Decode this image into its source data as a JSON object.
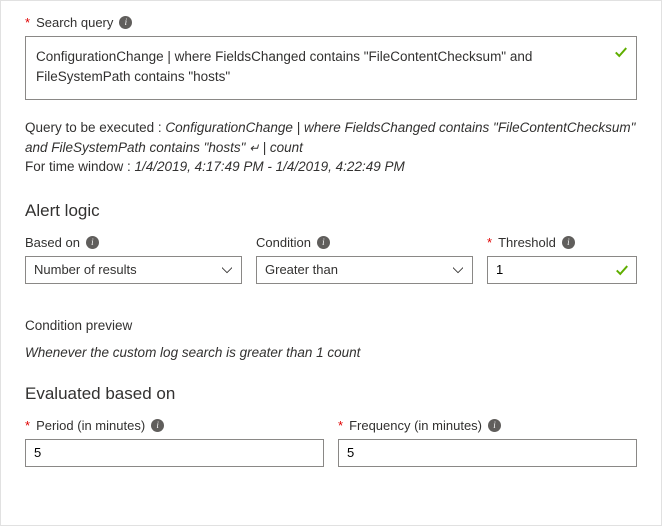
{
  "search_query": {
    "label": "Search query",
    "value": "ConfigurationChange | where FieldsChanged contains \"FileContentChecksum\" and FileSystemPath contains \"hosts\""
  },
  "query_meta": {
    "prefix": "Query to be executed : ",
    "italic_primary": "ConfigurationChange | where FieldsChanged contains \"FileContentChecksum\" and FileSystemPath contains \"hosts\" ",
    "italic_suffix": "| count",
    "time_prefix": "For time window : ",
    "time_value": "1/4/2019, 4:17:49 PM - 1/4/2019, 4:22:49 PM"
  },
  "sections": {
    "alert_logic": "Alert logic",
    "evaluated": "Evaluated based on"
  },
  "alert": {
    "based_on": {
      "label": "Based on",
      "value": "Number of results"
    },
    "condition": {
      "label": "Condition",
      "value": "Greater than"
    },
    "threshold": {
      "label": "Threshold",
      "value": "1"
    }
  },
  "condition_preview": {
    "label": "Condition preview",
    "text": "Whenever the custom log search is greater than 1 count"
  },
  "evaluated": {
    "period": {
      "label": "Period (in minutes)",
      "value": "5"
    },
    "frequency": {
      "label": "Frequency (in minutes)",
      "value": "5"
    }
  }
}
